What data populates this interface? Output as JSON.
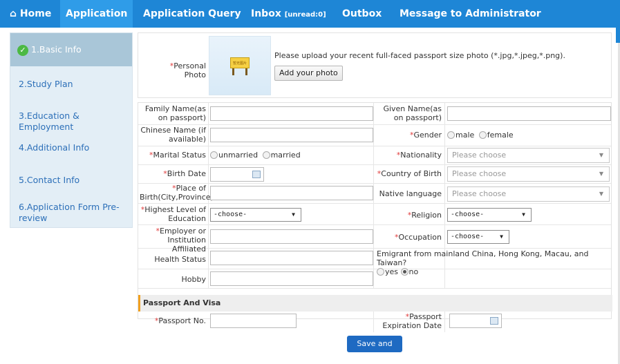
{
  "nav": {
    "home": "Home",
    "application": "Application",
    "application_query": "Application Query",
    "inbox": "Inbox",
    "inbox_unread": "[unread:0]",
    "outbox": "Outbox",
    "message_admin": "Message to Administrator"
  },
  "sidebar": {
    "items": [
      {
        "label": "1.Basic Info"
      },
      {
        "label": "2.Study Plan"
      },
      {
        "label": "3.Education & Employment"
      },
      {
        "label": "4.Additional Info"
      },
      {
        "label": "5.Contact Info"
      },
      {
        "label": "6.Application Form Pre-review"
      }
    ]
  },
  "photo": {
    "label": "Personal Photo",
    "sign_text": "暂无图片",
    "instruction": "Please upload your recent full-faced passport size photo (*.jpg,*.jpeg,*.png).",
    "add_button": "Add your photo"
  },
  "form": {
    "family_name": "Family Name(as on passport)",
    "given_name": "Given Name(as on passport)",
    "chinese_name": "Chinese Name (if available)",
    "gender": "Gender",
    "gender_male": "male",
    "gender_female": "female",
    "marital_status": "Marital Status",
    "marital_unmarried": "unmarried",
    "marital_married": "married",
    "nationality": "Nationality",
    "nationality_placeholder": "Please choose",
    "birth_date": "Birth Date",
    "country_of_birth": "Country of Birth",
    "country_placeholder": "Please choose",
    "place_of_birth": "Place of Birth(City,Province)",
    "native_language": "Native language",
    "native_placeholder": "Please choose",
    "highest_education": "Highest Level of Education",
    "highest_education_value": "-choose-",
    "religion": "Religion",
    "religion_value": "-choose-",
    "employer": "Employer or Institution Affiliated",
    "occupation": "Occupation",
    "occupation_value": "-choose-",
    "health_status": "Health Status",
    "emigrant_question": "Emigrant from mainland China, Hong Kong, Macau, and Taiwan?",
    "emigrant_yes": "yes",
    "emigrant_no": "no",
    "hobby": "Hobby"
  },
  "passport": {
    "section_title": "Passport And Visa",
    "passport_no": "Passport No.",
    "expiration_date": "Passport Expiration Date"
  },
  "save_button": "Save and Next",
  "colors": {
    "nav_bg": "#1e86d6",
    "accent_required": "#e03a3a",
    "save_button": "#1e6ac2"
  }
}
